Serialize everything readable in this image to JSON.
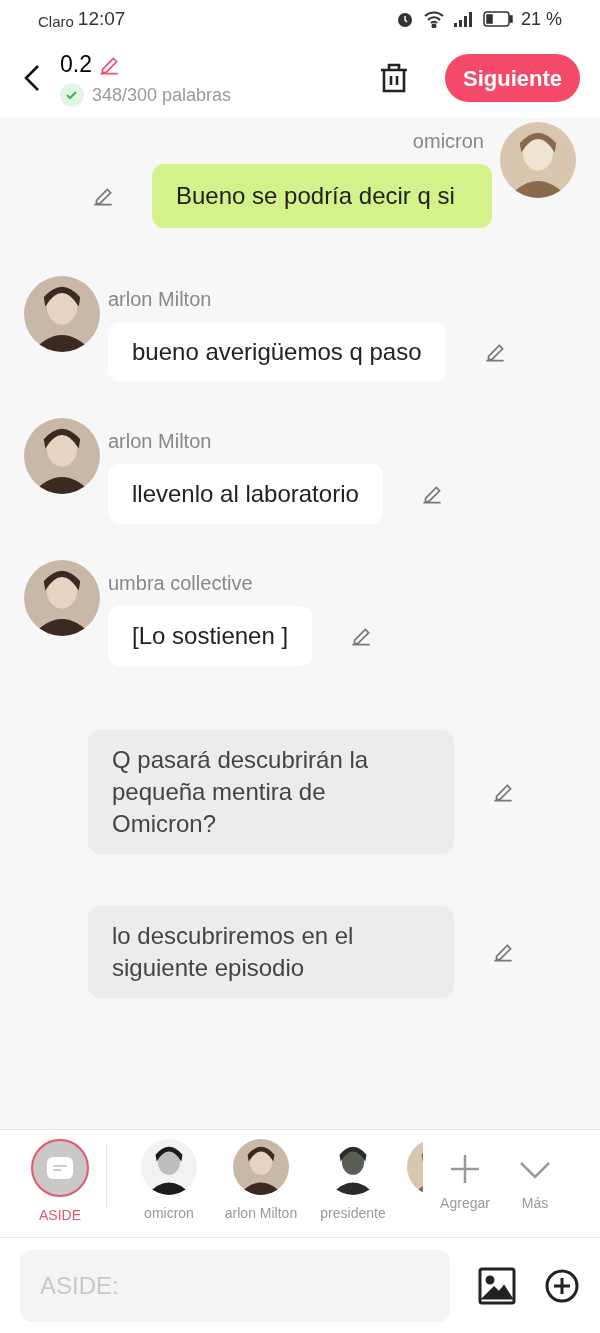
{
  "status_bar": {
    "carrier": "Claro",
    "time": "12:07",
    "battery": "21 %"
  },
  "header": {
    "title": "0.2",
    "word_count": "348/300 palabras",
    "word_goal_met": true,
    "next_button": "Siguiente"
  },
  "messages": [
    {
      "kind": "self",
      "speaker": "omicron",
      "text": "Bueno se podría decir q si"
    },
    {
      "kind": "other",
      "speaker": "arlon Milton",
      "text": "bueno averigüemos q paso"
    },
    {
      "kind": "other",
      "speaker": "arlon Milton",
      "text": "llevenlo al laboratorio"
    },
    {
      "kind": "other",
      "speaker": "umbra collective",
      "text": "[Lo sostienen ]"
    },
    {
      "kind": "aside",
      "text": "Q pasará descubrirán la pequeña mentira de Omicron?"
    },
    {
      "kind": "aside",
      "text": "lo descubriremos en el siguiente episodio"
    }
  ],
  "characters": [
    {
      "kind": "aside",
      "name": "ASIDE",
      "selected": true
    },
    {
      "kind": "person",
      "name": "omicron",
      "selected": false
    },
    {
      "kind": "person",
      "name": "arlon Milton",
      "selected": false
    },
    {
      "kind": "person",
      "name": "presidente",
      "selected": false
    },
    {
      "kind": "partial",
      "selected": false
    }
  ],
  "add_label": "Agregar",
  "more_label": "Más",
  "input": {
    "placeholder": "ASIDE:"
  }
}
